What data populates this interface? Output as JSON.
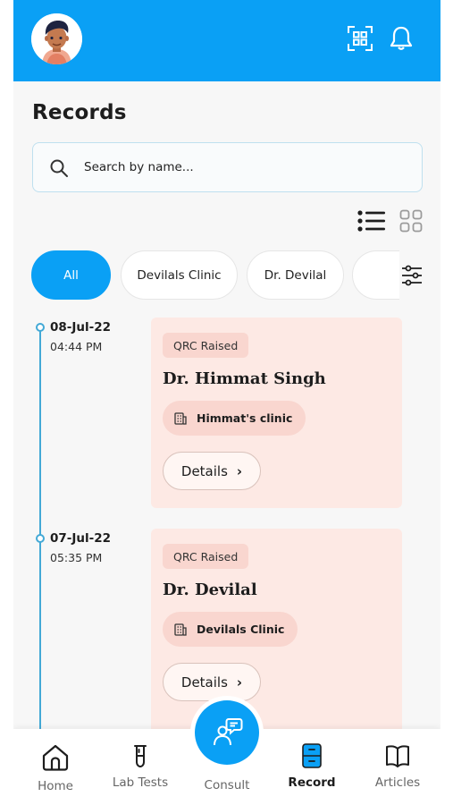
{
  "header": {
    "avatar_icon": "user-avatar",
    "qr_icon": "qr-scan-icon",
    "bell_icon": "bell-icon",
    "accent_color": "#0aa0f5"
  },
  "page": {
    "title": "Records"
  },
  "search": {
    "placeholder": "Search by name...",
    "value": ""
  },
  "view_toggle": {
    "list_icon": "list-view-icon",
    "grid_icon": "grid-view-icon",
    "selected": "list"
  },
  "filters": {
    "chips": [
      {
        "label": "All",
        "active": true
      },
      {
        "label": "Devilals Clinic",
        "active": false
      },
      {
        "label": "Dr. Devilal",
        "active": false
      },
      {
        "label": "",
        "active": false
      }
    ],
    "filter_icon": "sliders-icon"
  },
  "records": [
    {
      "date": "08-Jul-22",
      "time": "04:44 PM",
      "status": "QRC Raised",
      "doctor": "Dr. Himmat Singh",
      "clinic": "Himmat's clinic",
      "details_label": "Details"
    },
    {
      "date": "07-Jul-22",
      "time": "05:35 PM",
      "status": "QRC Raised",
      "doctor": "Dr. Devilal",
      "clinic": "Devilals Clinic",
      "details_label": "Details"
    }
  ],
  "bottom_nav": {
    "home": "Home",
    "lab_tests": "Lab Tests",
    "consult": "Consult",
    "record": "Record",
    "articles": "Articles",
    "active": "record"
  }
}
